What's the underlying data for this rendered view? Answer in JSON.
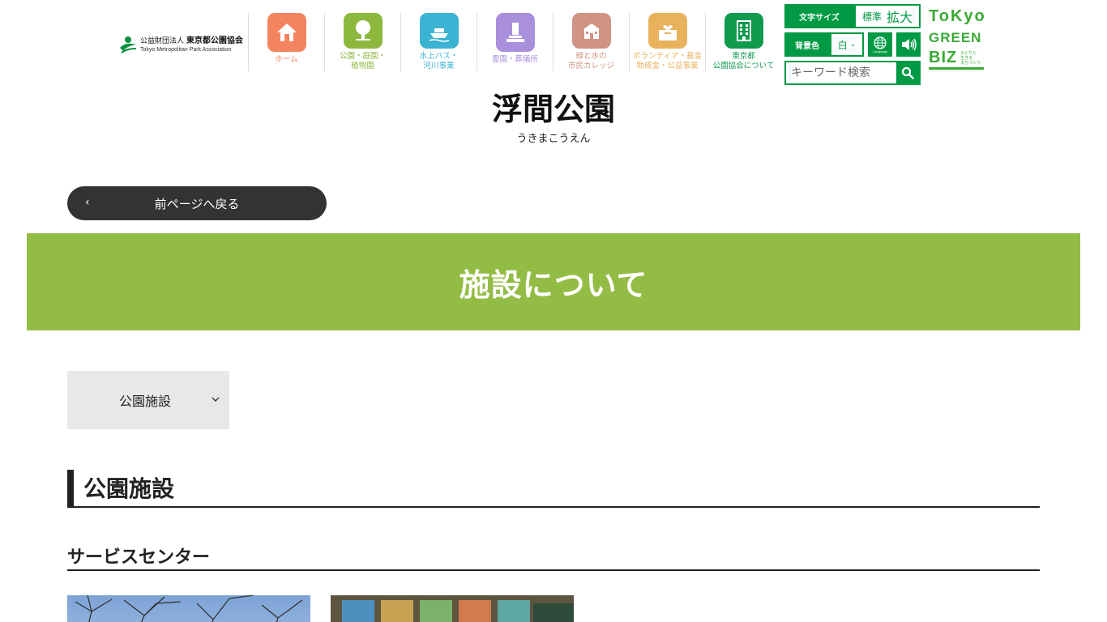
{
  "header": {
    "logo": {
      "org_line": "公益財団法人",
      "org_name": "東京都公園協会",
      "org_en": "Tokyo Metropolitan Park Association"
    },
    "nav": [
      {
        "label": "ホーム",
        "color": "#f4845f",
        "label_color": "#f4845f",
        "icon": "home-icon"
      },
      {
        "label": "公園・庭園・\n植物園",
        "color": "#8cb83e",
        "label_color": "#8cb83e",
        "icon": "tree-icon"
      },
      {
        "label": "水上バス・\n河川事業",
        "color": "#3bb3d2",
        "label_color": "#3bb3d2",
        "icon": "boat-icon"
      },
      {
        "label": "霊園・葬儀所",
        "color": "#a98fdc",
        "label_color": "#a98fdc",
        "icon": "grave-icon"
      },
      {
        "label": "緑と水の\n市民カレッジ",
        "color": "#d09484",
        "label_color": "#d09484",
        "icon": "school-icon"
      },
      {
        "label": "ボランティア・基金\n助成金・公益事業",
        "color": "#e8b25c",
        "label_color": "#e8b25c",
        "icon": "donation-box-icon"
      },
      {
        "label": "東京都\n公園協会について",
        "color": "#0f9a4e",
        "label_color": "#0f9a4e",
        "icon": "building-icon"
      }
    ],
    "tools": {
      "font_size_label": "文字サイズ",
      "font_size_standard": "標準",
      "font_size_large": "拡大",
      "bg_color_label": "背景色",
      "bg_color_value": "白",
      "language_label": "Language",
      "search_placeholder": "キーワード検索"
    },
    "tokyo_green_biz": {
      "line1": "ToKyo",
      "line2": "GREEN",
      "line3": "BIZ",
      "tagline": "みどりと\n生きる\nまちづくり"
    }
  },
  "page": {
    "title": "浮間公園",
    "title_kana": "うきまこうえん",
    "back_label": "前ページへ戻る",
    "banner_title": "施設について",
    "dropdown_label": "公園施設",
    "section_heading": "公園施設",
    "sub_heading": "サービスセンター"
  },
  "colors": {
    "brand_green": "#009a44",
    "banner_green": "#93bc45",
    "tgb_green": "#3aa935",
    "dark": "#333333"
  }
}
